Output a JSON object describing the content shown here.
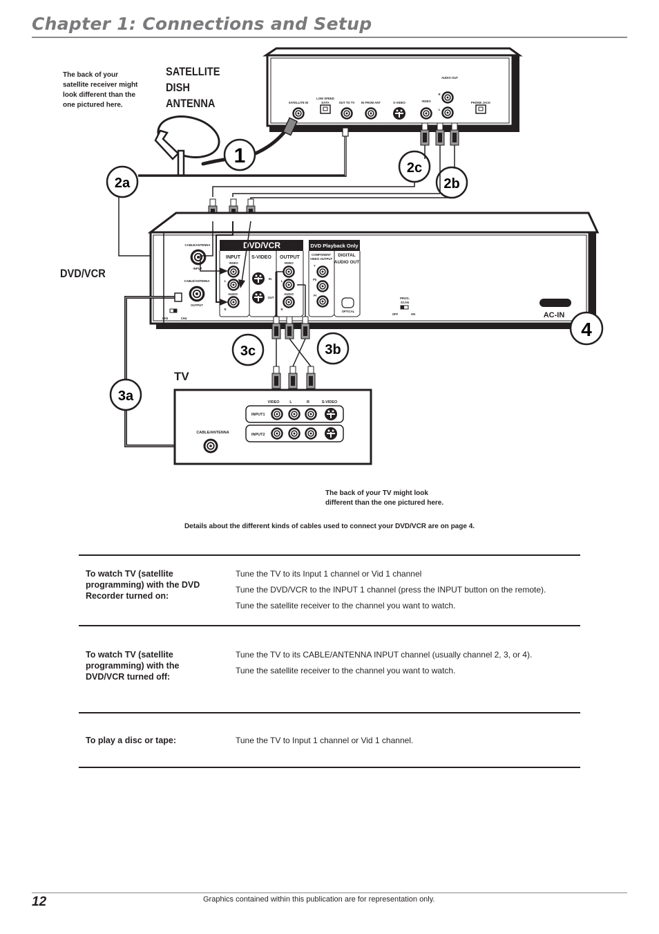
{
  "header": {
    "chapter_title": "Chapter 1: Connections and Setup"
  },
  "diagram": {
    "receiver_note": "The back of your satellite receiver might look different than the one pictured here.",
    "receiver_note_lines": [
      "The back of your",
      "satellite receiver might",
      "look different than the",
      "one pictured here."
    ],
    "dish_label_lines": [
      "SATELLITE",
      "DISH",
      "ANTENNA"
    ],
    "dvdvcr_label": "DVD/VCR",
    "tv_label": "TV",
    "tv_note_lines": [
      "The back of your TV might look",
      "different than the one pictured here."
    ],
    "cables_note": "Details about the different kinds of cables used to connect your DVD/VCR are on page 4.",
    "steps": [
      "1",
      "2a",
      "2b",
      "2c",
      "3a",
      "3b",
      "3c",
      "4"
    ],
    "receiver_ports": {
      "satellite_in": "SATELLITE IN",
      "low_speed_data_1": "LOW SPEED",
      "low_speed_data_2": "DATA",
      "out_to_tv": "OUT TO TV",
      "in_from_ant": "IN FROM ANT",
      "s_video": "S-VIDEO",
      "video": "VIDEO",
      "audio_out": "AUDIO OUT",
      "audio_r": "R",
      "audio_l": "L",
      "phone_jack": "PHONE JACK"
    },
    "dvdvcr_ports": {
      "cable_antenna": "CABLE/ANTENNA",
      "input": "INPUT",
      "output": "OUTPUT",
      "ch3": "CH3",
      "ch4": "CH4",
      "panel_title": "DVD/VCR",
      "input_group": "INPUT",
      "svideo_group": "S-VIDEO",
      "output_group": "OUTPUT",
      "video": "VIDEO",
      "audio": "AUDIO",
      "l": "L",
      "r": "R",
      "in": "IN",
      "out": "OUT",
      "playback_title": "DVD Playback Only",
      "component_1": "COMPONENT",
      "component_2": "VIDEO OUTPUT",
      "y": "Y",
      "pb": "Pb",
      "pr": "Pr",
      "digital_1": "DIGITAL",
      "digital_2": "AUDIO OUT",
      "optical": "OPTICAL",
      "prog_1": "PROG.",
      "prog_2": "SCAN",
      "off": "OFF",
      "on": "ON",
      "ac_in": "AC-IN"
    },
    "tv_ports": {
      "video": "VIDEO",
      "l": "L",
      "r": "R",
      "s_video": "S-VIDEO",
      "input1": "INPUT1",
      "input2": "INPUT2",
      "cable_antenna": "CABLE/ANTENNA"
    }
  },
  "table": {
    "rows": [
      {
        "heading_lines": [
          "To watch TV (satellite",
          "programming) with the DVD",
          "Recorder turned on:"
        ],
        "steps": [
          "Tune the TV to its Input 1 channel or Vid 1 channel",
          "Tune the DVD/VCR to the INPUT 1 channel (press the INPUT button on the remote).",
          "Tune the satellite receiver to the channel you want to watch."
        ]
      },
      {
        "heading_lines": [
          "To watch TV (satellite",
          "programming) with the",
          "DVD/VCR turned off:"
        ],
        "steps": [
          "Tune the TV to its CABLE/ANTENNA INPUT channel (usually channel 2, 3, or 4).",
          "Tune the satellite receiver to the channel you want to watch."
        ]
      },
      {
        "heading_lines": [
          "To play a disc or tape:"
        ],
        "steps": [
          "Tune the TV to Input 1 channel or Vid 1 channel."
        ]
      }
    ]
  },
  "footer": {
    "page_number": "12",
    "note": "Graphics contained within this publication are for representation only."
  }
}
